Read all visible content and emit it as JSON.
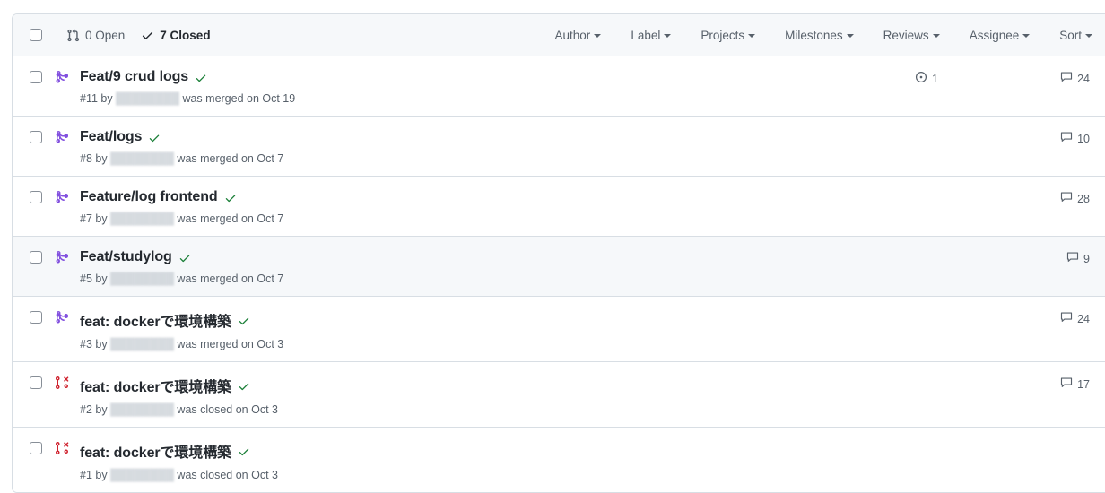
{
  "colors": {
    "merged": "#8250df",
    "closed": "#cf222e",
    "verified": "#1a7f37",
    "muted": "#57606a",
    "text": "#24292f",
    "header_bg": "#f6f8fa",
    "border": "#d8dee4",
    "hover_bg": "#f6f8fa"
  },
  "header": {
    "select_all_checkbox": "select-all",
    "open": {
      "icon": "pull-request-icon",
      "label": "0 Open"
    },
    "closed": {
      "icon": "check-icon",
      "label": "7 Closed"
    },
    "filters": [
      {
        "label": "Author",
        "name": "author"
      },
      {
        "label": "Label",
        "name": "label"
      },
      {
        "label": "Projects",
        "name": "projects"
      },
      {
        "label": "Milestones",
        "name": "milestones"
      },
      {
        "label": "Reviews",
        "name": "reviews"
      },
      {
        "label": "Assignee",
        "name": "assignee"
      },
      {
        "label": "Sort",
        "name": "sort"
      }
    ]
  },
  "rows": [
    {
      "title": "Feat/9 crud logs",
      "state": "merged",
      "state_icon": "git-merge-icon",
      "verified_icon": "check-icon",
      "number": "#11",
      "by": "by",
      "author_redacted": true,
      "action": "was merged on Oct 19",
      "linked_count": "1",
      "linked_icon": "issue-opened-icon",
      "comments": "24",
      "comments_icon": "comment-icon",
      "hovered": false
    },
    {
      "title": "Feat/logs",
      "state": "merged",
      "state_icon": "git-merge-icon",
      "verified_icon": "check-icon",
      "number": "#8",
      "by": "by",
      "author_redacted": true,
      "action": "was merged on Oct 7",
      "linked_count": "",
      "linked_icon": "",
      "comments": "10",
      "comments_icon": "comment-icon",
      "hovered": false
    },
    {
      "title": "Feature/log frontend",
      "state": "merged",
      "state_icon": "git-merge-icon",
      "verified_icon": "check-icon",
      "number": "#7",
      "by": "by",
      "author_redacted": true,
      "action": "was merged on Oct 7",
      "linked_count": "",
      "linked_icon": "",
      "comments": "28",
      "comments_icon": "comment-icon",
      "hovered": false
    },
    {
      "title": "Feat/studylog",
      "state": "merged",
      "state_icon": "git-merge-icon",
      "verified_icon": "check-icon",
      "number": "#5",
      "by": "by",
      "author_redacted": true,
      "action": "was merged on Oct 7",
      "linked_count": "",
      "linked_icon": "",
      "comments": "9",
      "comments_icon": "comment-icon",
      "hovered": true
    },
    {
      "title": "feat: dockerで環境構築",
      "state": "merged",
      "state_icon": "git-merge-icon",
      "verified_icon": "check-icon",
      "number": "#3",
      "by": "by",
      "author_redacted": true,
      "action": "was merged on Oct 3",
      "linked_count": "",
      "linked_icon": "",
      "comments": "24",
      "comments_icon": "comment-icon",
      "hovered": false
    },
    {
      "title": "feat: dockerで環境構築",
      "state": "closed",
      "state_icon": "git-pull-request-closed-icon",
      "verified_icon": "check-icon",
      "number": "#2",
      "by": "by",
      "author_redacted": true,
      "action": "was closed on Oct 3",
      "linked_count": "",
      "linked_icon": "",
      "comments": "17",
      "comments_icon": "comment-icon",
      "hovered": false
    },
    {
      "title": "feat: dockerで環境構築",
      "state": "closed",
      "state_icon": "git-pull-request-closed-icon",
      "verified_icon": "check-icon",
      "number": "#1",
      "by": "by",
      "author_redacted": true,
      "action": "was closed on Oct 3",
      "linked_count": "",
      "linked_icon": "",
      "comments": "",
      "comments_icon": "",
      "hovered": false
    }
  ]
}
